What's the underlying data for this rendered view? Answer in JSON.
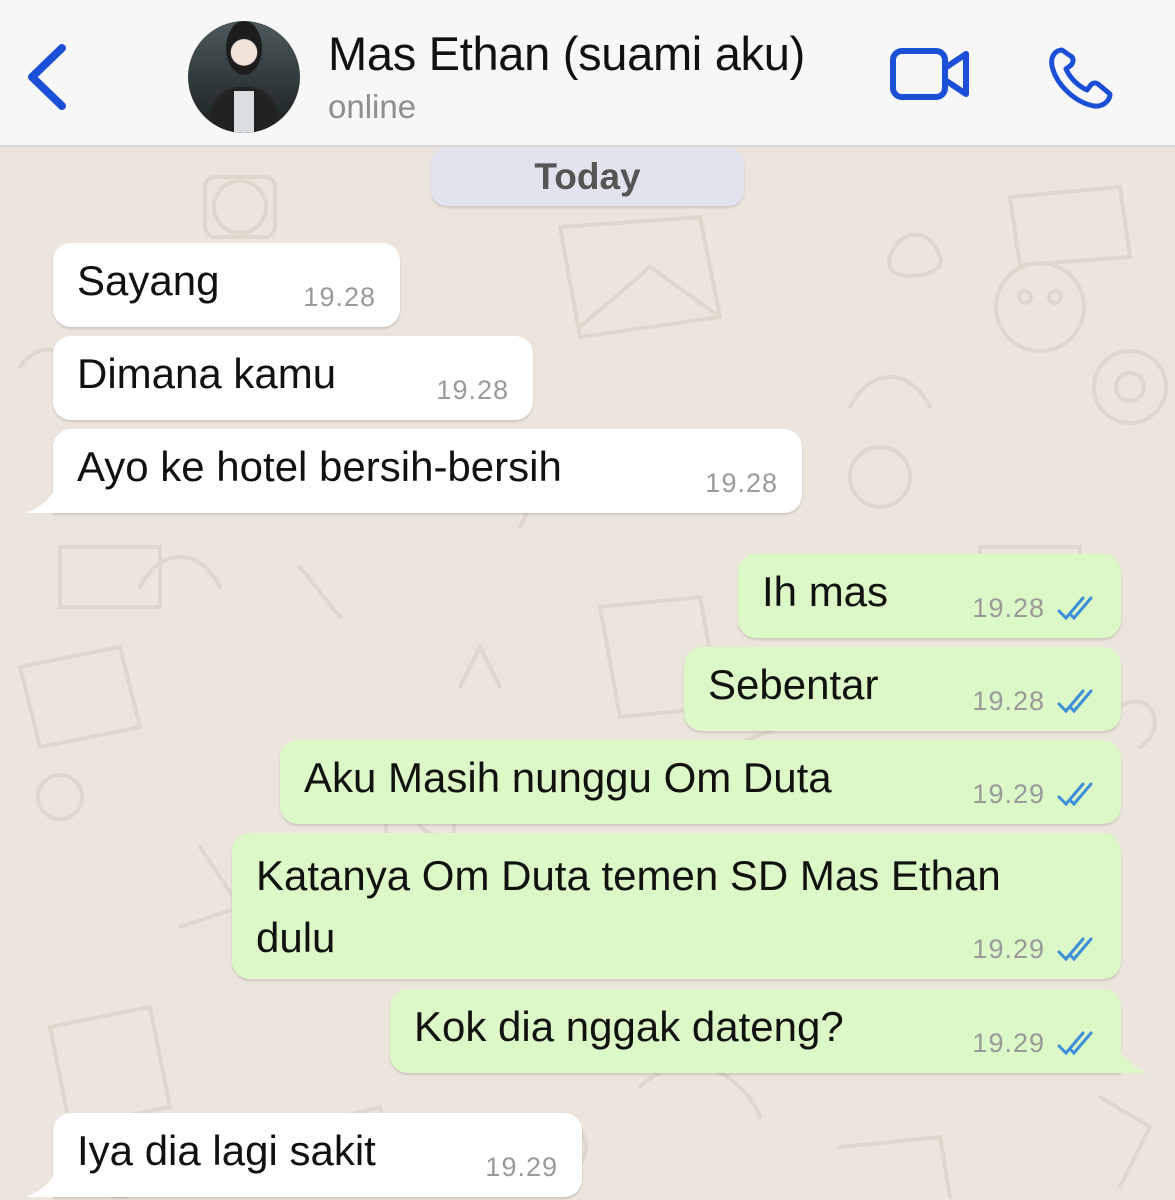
{
  "header": {
    "contact_name": "Mas Ethan (suami aku)",
    "status": "online",
    "accent_color": "#1c4fd8"
  },
  "chat": {
    "day_label": "Today",
    "messages": [
      {
        "direction": "incoming",
        "text": "Sayang",
        "time": "19.28"
      },
      {
        "direction": "incoming",
        "text": "Dimana kamu",
        "time": "19.28"
      },
      {
        "direction": "incoming",
        "text": "Ayo ke hotel bersih-bersih",
        "time": "19.28"
      },
      {
        "direction": "outgoing",
        "text": "Ih mas",
        "time": "19.28",
        "status": "read"
      },
      {
        "direction": "outgoing",
        "text": "Sebentar",
        "time": "19.28",
        "status": "read"
      },
      {
        "direction": "outgoing",
        "text": "Aku Masih nunggu Om Duta",
        "time": "19.29",
        "status": "read"
      },
      {
        "direction": "outgoing",
        "text": "Katanya Om Duta temen SD Mas Ethan dulu",
        "time": "19.29",
        "status": "read"
      },
      {
        "direction": "outgoing",
        "text": "Kok dia nggak dateng?",
        "time": "19.29",
        "status": "read"
      },
      {
        "direction": "incoming",
        "text": "Iya dia lagi sakit",
        "time": "19.29"
      }
    ]
  },
  "colors": {
    "incoming_bubble": "#ffffff",
    "outgoing_bubble": "#dcf8c6",
    "read_ticks": "#3c8fd8",
    "wallpaper": "#ece5dd"
  },
  "icons": {
    "back": "chevron-left-icon",
    "video": "video-camera-icon",
    "call": "phone-icon",
    "read_receipt": "double-check-icon"
  }
}
